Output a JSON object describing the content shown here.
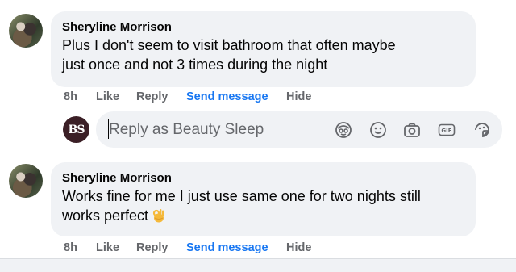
{
  "comments": [
    {
      "author": "Sheryline Morrison",
      "text_line1": "Plus I don't seem to visit bathroom that often maybe",
      "text_line2": "just once and not 3 times during the night",
      "time": "8h",
      "like": "Like",
      "reply": "Reply",
      "send_message": "Send message",
      "hide": "Hide"
    },
    {
      "author": "Sheryline Morrison",
      "text_line1": "Works fine for me I just use same one for two nights still",
      "text_line2": "works perfect",
      "emoji": "ok-hand-emoji",
      "time": "8h",
      "like": "Like",
      "reply": "Reply",
      "send_message": "Send message",
      "hide": "Hide"
    }
  ],
  "reply": {
    "avatar_initials": "BS",
    "placeholder": "Reply as Beauty Sleep",
    "icons": [
      "avatar-sticker-icon",
      "emoji-icon",
      "camera-icon",
      "gif-icon",
      "sticker-icon"
    ]
  },
  "colors": {
    "bubble": "#f0f2f5",
    "link": "#1877f2",
    "muted": "#65676b",
    "text": "#050505"
  }
}
